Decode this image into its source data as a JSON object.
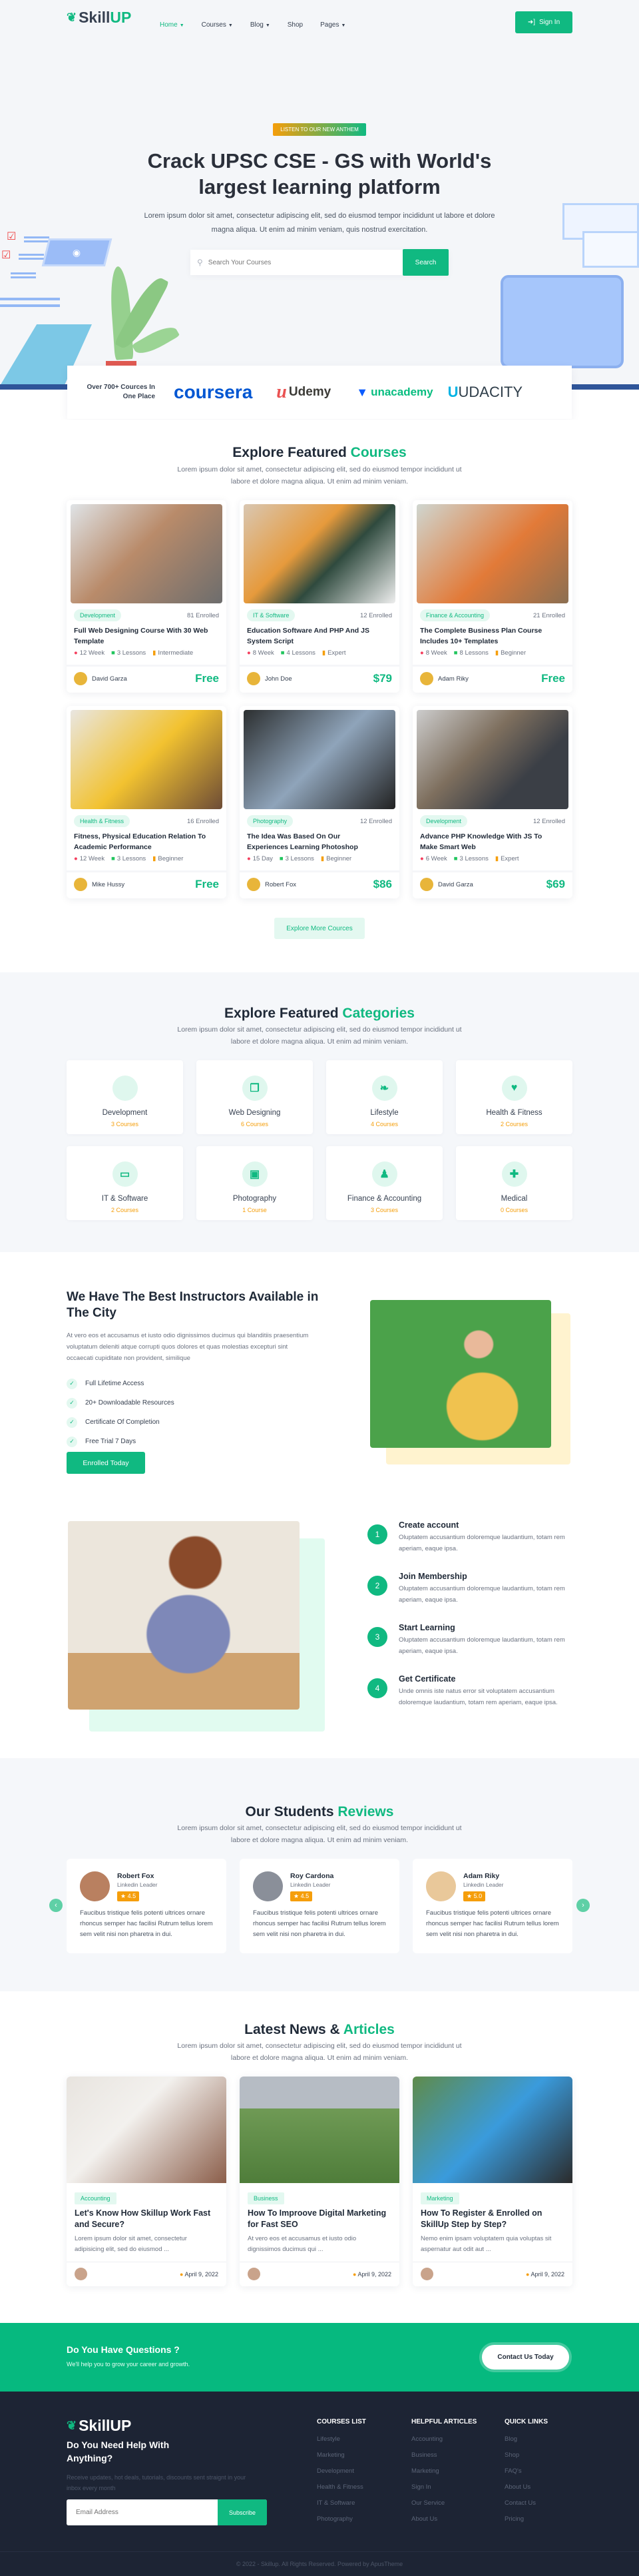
{
  "colors": {
    "accent": "#10b981",
    "accent_light": "#e3f8f0",
    "orange": "#f59e0b",
    "footer_bg": "#1d2434"
  },
  "nav": {
    "logo_left": "Skill",
    "logo_right": "UP",
    "items": [
      {
        "label": "Home",
        "active": true,
        "dropdown": true
      },
      {
        "label": "Courses",
        "dropdown": true
      },
      {
        "label": "Blog",
        "dropdown": true
      },
      {
        "label": "Shop",
        "dropdown": false
      },
      {
        "label": "Pages",
        "dropdown": true
      }
    ],
    "sign_in": "Sign In",
    "sign_in_icon": "sign-in-icon"
  },
  "hero": {
    "badge": "LISTEN TO OUR NEW ANTHEM",
    "title_line1": "Crack UPSC CSE - GS with World's",
    "title_line2": "largest learning platform",
    "desc": "Lorem ipsum dolor sit amet, consectetur adipiscing elit, sed do eiusmod tempor incididunt ut labore et dolore magna aliqua. Ut enim ad minim veniam, quis nostrud exercitation.",
    "search_placeholder": "Search Your Courses",
    "search_button": "Search"
  },
  "brands": {
    "label": "Over 700+ Cources In One Place",
    "logos": [
      "coursera",
      "Udemy",
      "unacademy",
      "UDACITY"
    ]
  },
  "courses": {
    "title": "Explore Featured ",
    "title_accent": "Courses",
    "desc": "Lorem ipsum dolor sit amet, consectetur adipiscing elit, sed do eiusmod tempor incididunt ut labore et dolore magna aliqua. Ut enim ad minim veniam.",
    "more_button": "Explore More Cources",
    "items": [
      {
        "tag": "Development",
        "enrolled": "81 Enrolled",
        "title": "Full Web Designing Course With 30 Web Template",
        "duration": "12 Week",
        "lessons": "3 Lessons",
        "level": "Intermediate",
        "author": "David Garza",
        "price": "Free"
      },
      {
        "tag": "IT & Software",
        "enrolled": "12 Enrolled",
        "title": "Education Software And PHP And JS System Script",
        "duration": "8 Week",
        "lessons": "4 Lessons",
        "level": "Expert",
        "author": "John Doe",
        "price": "$79"
      },
      {
        "tag": "Finance & Accounting",
        "enrolled": "21 Enrolled",
        "title": "The Complete Business Plan Course Includes 10+ Templates",
        "duration": "8 Week",
        "lessons": "8 Lessons",
        "level": "Beginner",
        "author": "Adam Riky",
        "price": "Free"
      },
      {
        "tag": "Health & Fitness",
        "enrolled": "16 Enrolled",
        "title": "Fitness, Physical Education Relation To Academic Performance",
        "duration": "12 Week",
        "lessons": "3 Lessons",
        "level": "Beginner",
        "author": "Mike Hussy",
        "price": "Free"
      },
      {
        "tag": "Photography",
        "enrolled": "12 Enrolled",
        "title": "The Idea Was Based On Our Experiences Learning Photoshop",
        "duration": "15 Day",
        "lessons": "3 Lessons",
        "level": "Beginner",
        "author": "Robert Fox",
        "price": "$86"
      },
      {
        "tag": "Development",
        "enrolled": "12 Enrolled",
        "title": "Advance PHP Knowledge With JS To Make Smart Web",
        "duration": "6 Week",
        "lessons": "3 Lessons",
        "level": "Expert",
        "author": "David Garza",
        "price": "$69"
      }
    ]
  },
  "categories": {
    "title": "Explore Featured ",
    "title_accent": "Categories",
    "desc": "Lorem ipsum dolor sit amet, consectetur adipiscing elit, sed do eiusmod tempor incididunt ut labore et dolore magna aliqua. Ut enim ad minim veniam.",
    "items": [
      {
        "name": "Development",
        "count": "3 Courses",
        "icon": "code-icon"
      },
      {
        "name": "Web Designing",
        "count": "6 Courses",
        "icon": "copy-icon"
      },
      {
        "name": "Lifestyle",
        "count": "4 Courses",
        "icon": "leaf-icon"
      },
      {
        "name": "Health & Fitness",
        "count": "2 Courses",
        "icon": "heartbeat-icon"
      },
      {
        "name": "IT & Software",
        "count": "2 Courses",
        "icon": "laptop-icon"
      },
      {
        "name": "Photography",
        "count": "1 Course",
        "icon": "photo-film-icon"
      },
      {
        "name": "Finance & Accounting",
        "count": "3 Courses",
        "icon": "stamp-icon"
      },
      {
        "name": "Medical",
        "count": "0 Courses",
        "icon": "medical-kit-icon"
      }
    ]
  },
  "instructors": {
    "title": "We Have The Best Instructors Available in The City",
    "desc": "At vero eos et accusamus et iusto odio dignissimos ducimus qui blanditiis praesentium voluptatum deleniti atque corrupti quos dolores et quas molestias excepturi sint occaecati cupiditate non provident, similique",
    "features": [
      "Full Lifetime Access",
      "20+ Downloadable Resources",
      "Certificate Of Completion",
      "Free Trial 7 Days"
    ],
    "button": "Enrolled Today"
  },
  "steps": [
    {
      "num": "1",
      "title": "Create account",
      "desc": "Oluptatem accusantium doloremque laudantium, totam rem aperiam, eaque ipsa."
    },
    {
      "num": "2",
      "title": "Join Membership",
      "desc": "Oluptatem accusantium doloremque laudantium, totam rem aperiam, eaque ipsa."
    },
    {
      "num": "3",
      "title": "Start Learning",
      "desc": "Oluptatem accusantium doloremque laudantium, totam rem aperiam, eaque ipsa."
    },
    {
      "num": "4",
      "title": "Get Certificate",
      "desc": "Unde omnis iste natus error sit voluptatem accusantium doloremque laudantium, totam rem aperiam, eaque ipsa."
    }
  ],
  "reviews": {
    "title": "Our Students ",
    "title_accent": "Reviews",
    "desc": "Lorem ipsum dolor sit amet, consectetur adipiscing elit, sed do eiusmod tempor incididunt ut labore et dolore magna aliqua. Ut enim ad minim veniam.",
    "items": [
      {
        "name": "Robert Fox",
        "role": "Linkedin Leader",
        "rating": "4.5",
        "text": "Faucibus tristique felis potenti ultrices ornare rhoncus semper hac facilisi Rutrum tellus lorem sem velit nisi non pharetra in dui."
      },
      {
        "name": "Roy Cardona",
        "role": "Linkedin Leader",
        "rating": "4.5",
        "text": "Faucibus tristique felis potenti ultrices ornare rhoncus semper hac facilisi Rutrum tellus lorem sem velit nisi non pharetra in dui."
      },
      {
        "name": "Adam Riky",
        "role": "Linkedin Leader",
        "rating": "5.0",
        "text": "Faucibus tristique felis potenti ultrices ornare rhoncus semper hac facilisi Rutrum tellus lorem sem velit nisi non pharetra in dui."
      }
    ]
  },
  "news": {
    "title": "Latest News & ",
    "title_accent": "Articles",
    "desc": "Lorem ipsum dolor sit amet, consectetur adipiscing elit, sed do eiusmod tempor incididunt ut labore et dolore magna aliqua. Ut enim ad minim veniam.",
    "items": [
      {
        "tag": "Accounting",
        "title": "Let's Know How Skillup Work Fast and Secure?",
        "excerpt": "Lorem ipsum dolor sit amet, consectetur adipisicing elit, sed do eiusmod ...",
        "date": "April 9, 2022"
      },
      {
        "tag": "Business",
        "title": "How To Improove Digital Marketing for Fast SEO",
        "excerpt": "At vero eos et accusamus et iusto odio dignissimos ducimus qui ...",
        "date": "April 9, 2022"
      },
      {
        "tag": "Marketing",
        "title": "How To Register & Enrolled on SkillUp Step by Step?",
        "excerpt": "Nemo enim ipsam voluptatem quia voluptas sit aspernatur aut odit aut ...",
        "date": "April 9, 2022"
      }
    ]
  },
  "cta": {
    "title": "Do You Have Questions ?",
    "subtitle": "We'll help you to grow your career and growth.",
    "button": "Contact Us Today"
  },
  "footer": {
    "logo_left": "Skill",
    "logo_right": "UP",
    "headline": "Do You Need Help With Anything?",
    "desc": "Receive updates, hot deals, tutorials, discounts sent straignt in your inbox every month",
    "email_placeholder": "Email Address",
    "subscribe": "Subscribe",
    "columns": [
      {
        "title": "COURSES LIST",
        "links": [
          "Lifestyle",
          "Marketing",
          "Development",
          "Health & Fitness",
          "IT & Software",
          "Photography"
        ]
      },
      {
        "title": "HELPFUL ARTICLES",
        "links": [
          "Accounting",
          "Business",
          "Marketing",
          "Sign In",
          "Our Service",
          "About Us"
        ]
      },
      {
        "title": "QUICK LINKS",
        "links": [
          "Blog",
          "Shop",
          "FAQ's",
          "About Us",
          "Contact Us",
          "Pricing"
        ]
      }
    ],
    "copyright": "© 2022 - Skillup. All Rights Reserved. Powered by ApusTheme"
  }
}
